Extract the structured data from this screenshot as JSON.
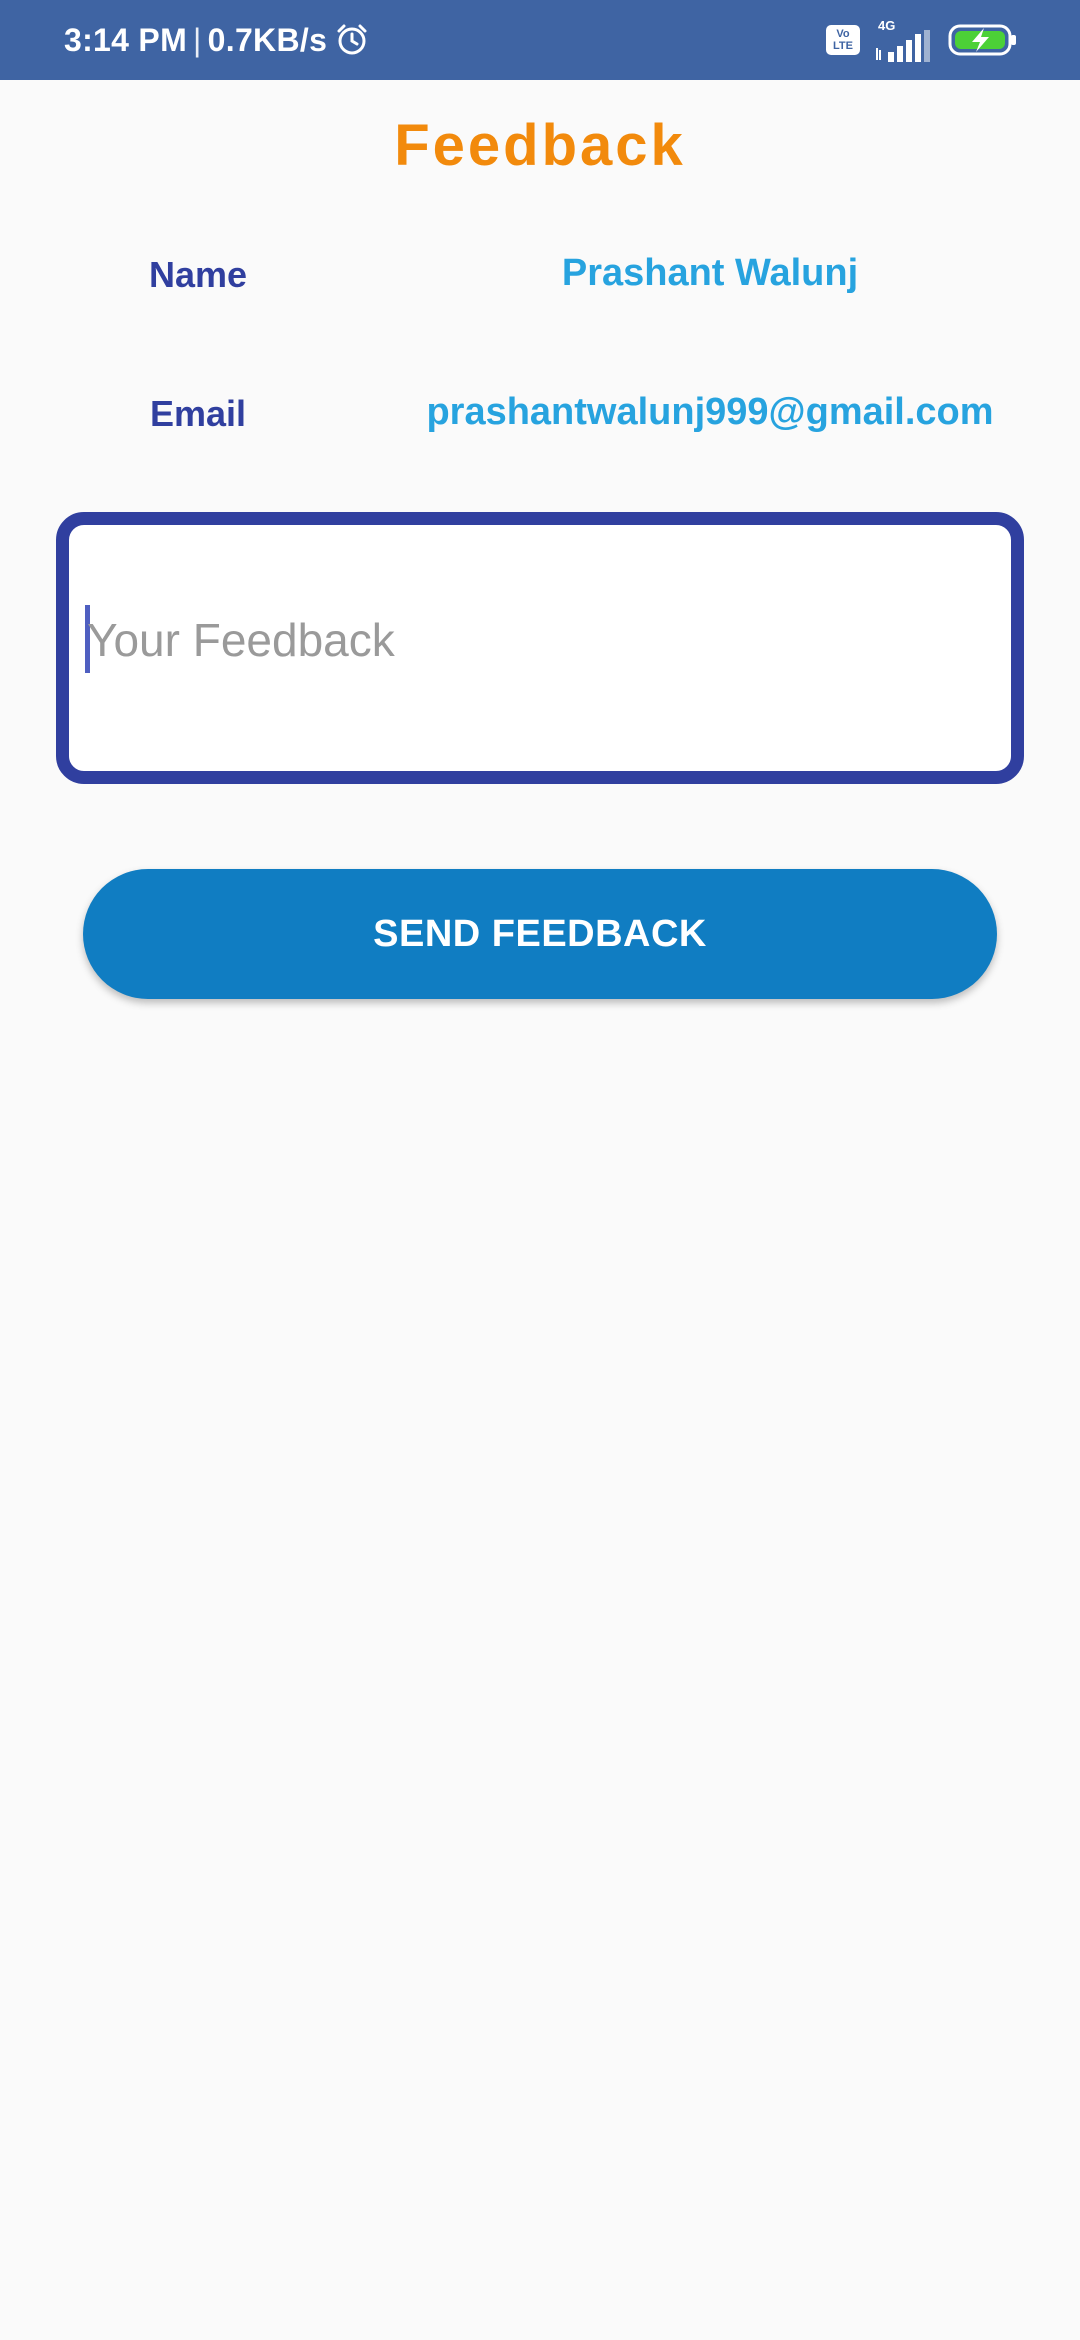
{
  "status_bar": {
    "time": "3:14 PM",
    "separator": "|",
    "network_speed": "0.7KB/s",
    "alarm_icon": "alarm-clock-icon",
    "volte_top": "Vo",
    "volte_bottom": "LTE",
    "network_type": "4G",
    "signal_icon": "cell-signal-icon",
    "battery_icon": "battery-charging-icon",
    "colors": {
      "background": "#3f64a3",
      "battery": "#4cd137"
    }
  },
  "header": {
    "title": "Feedback",
    "title_color": "#f28a0c"
  },
  "user": {
    "name_label": "Name",
    "name_value": "Prashant Walunj",
    "email_label": "Email",
    "email_value": "prashantwalunj999@gmail.com",
    "label_color": "#303f9f",
    "value_color": "#27a3df"
  },
  "feedback": {
    "placeholder": "Your Feedback",
    "value": "",
    "border_color": "#303f9f"
  },
  "actions": {
    "send_label": "SEND FEEDBACK",
    "button_color": "#107dc2"
  }
}
